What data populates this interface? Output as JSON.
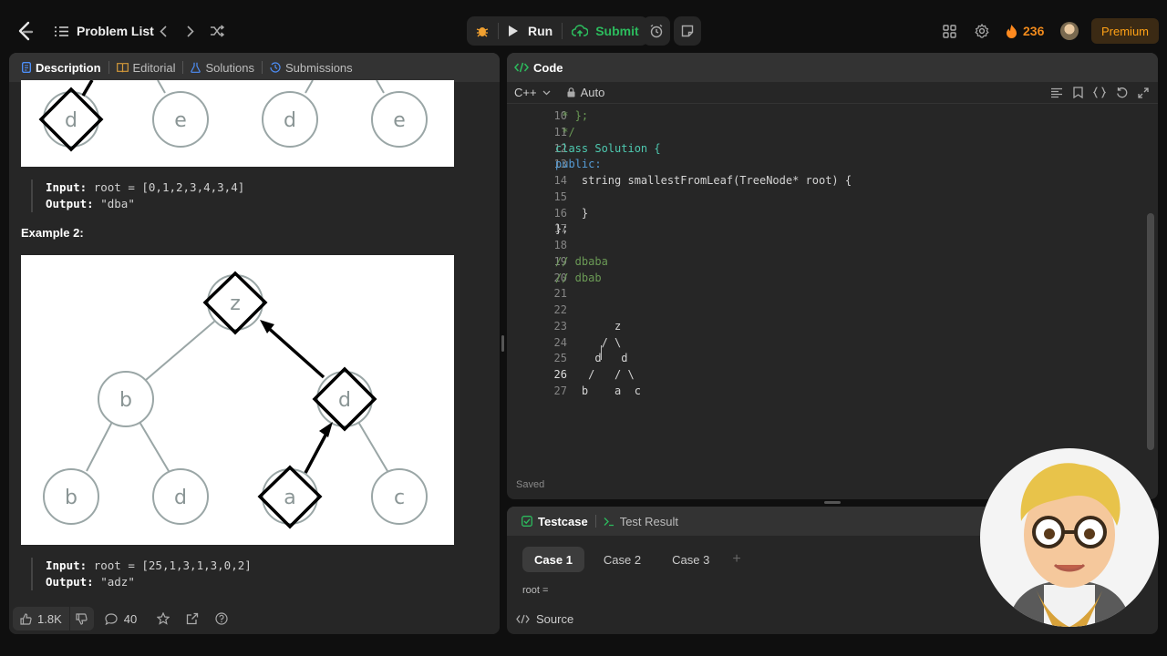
{
  "topbar": {
    "problem_list": "Problem List",
    "run": "Run",
    "submit": "Submit",
    "streak": "236",
    "premium": "Premium"
  },
  "left": {
    "tabs": {
      "description": "Description",
      "editorial": "Editorial",
      "solutions": "Solutions",
      "submissions": "Submissions"
    },
    "ex1_tree_nodes": [
      "d",
      "e",
      "d",
      "e"
    ],
    "ex1": {
      "input_label": "Input:",
      "input_value": "root = [0,1,2,3,4,3,4]",
      "output_label": "Output:",
      "output_value": "\"dba\""
    },
    "example2_title": "Example 2:",
    "ex2_tree_nodes": {
      "root": "z",
      "l": "b",
      "r": "d",
      "ll": "b",
      "lr": "d",
      "rl": "a",
      "rr": "c"
    },
    "ex2": {
      "input_label": "Input:",
      "input_value": "root = [25,1,3,1,3,0,2]",
      "output_label": "Output:",
      "output_value": "\"adz\""
    },
    "footer": {
      "likes": "1.8K",
      "comments": "40"
    }
  },
  "code": {
    "title": "Code",
    "language": "C++",
    "mode": "Auto",
    "status": "Saved",
    "current_line": 26,
    "lines": [
      {
        "n": "10",
        "text": " * };"
      },
      {
        "n": "11",
        "text": " */"
      },
      {
        "n": "12",
        "text": "class Solution {"
      },
      {
        "n": "13",
        "text": "public:"
      },
      {
        "n": "14",
        "text": "    string smallestFromLeaf(TreeNode* root) {"
      },
      {
        "n": "15",
        "text": ""
      },
      {
        "n": "16",
        "text": "    }"
      },
      {
        "n": "17",
        "text": "};"
      },
      {
        "n": "18",
        "text": ""
      },
      {
        "n": "19",
        "text": "// dbaba"
      },
      {
        "n": "20",
        "text": "// dbab"
      },
      {
        "n": "21",
        "text": ""
      },
      {
        "n": "22",
        "text": ""
      },
      {
        "n": "23",
        "text": "         z"
      },
      {
        "n": "24",
        "text": "       / \\"
      },
      {
        "n": "25",
        "text": "      d   d"
      },
      {
        "n": "26",
        "text": "     /   / \\"
      },
      {
        "n": "27",
        "text": "    b    a  c"
      }
    ]
  },
  "testcase": {
    "tab_testcase": "Testcase",
    "tab_result": "Test Result",
    "cases": [
      "Case 1",
      "Case 2",
      "Case 3"
    ],
    "add": "+",
    "root_label": "root =",
    "source": "Source"
  },
  "colors": {
    "accent_green": "#2cbb5d",
    "orange": "#ffa116",
    "blue": "#4d8ef7"
  },
  "icons": [
    "logo-icon",
    "list-icon",
    "chevron-left-icon",
    "chevron-right-icon",
    "shuffle-icon",
    "debug-icon",
    "play-icon",
    "cloud-upload-icon",
    "alarm-icon",
    "note-icon",
    "layout-icon",
    "gear-icon",
    "fire-icon",
    "avatar"
  ]
}
